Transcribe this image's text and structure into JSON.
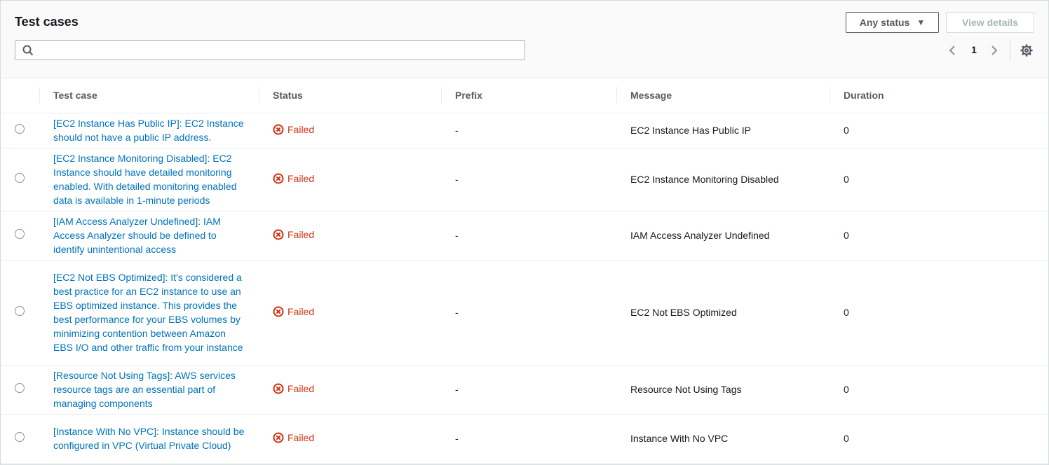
{
  "title": "Test cases",
  "search": {
    "placeholder": "",
    "value": ""
  },
  "filter": {
    "label": "Any status"
  },
  "view_details_label": "View details",
  "pagination": {
    "current_page": "1"
  },
  "columns": [
    "Test case",
    "Status",
    "Prefix",
    "Message",
    "Duration"
  ],
  "rows": [
    {
      "test_case": "[EC2 Instance Has Public IP]: EC2 Instance should not have a public IP address.",
      "status": "Failed",
      "prefix": "-",
      "message": "EC2 Instance Has Public IP",
      "duration": "0"
    },
    {
      "test_case": "[EC2 Instance Monitoring Disabled]: EC2 Instance should have detailed monitoring enabled. With detailed monitoring enabled data is available in 1-minute periods",
      "status": "Failed",
      "prefix": "-",
      "message": "EC2 Instance Monitoring Disabled",
      "duration": "0"
    },
    {
      "test_case": "[IAM Access Analyzer Undefined]: IAM Access Analyzer should be defined to identify unintentional access",
      "status": "Failed",
      "prefix": "-",
      "message": "IAM Access Analyzer Undefined",
      "duration": "0"
    },
    {
      "test_case": "[EC2 Not EBS Optimized]: It's considered a best practice for an EC2 instance to use an EBS optimized instance. This provides the best performance for your EBS volumes by minimizing contention between Amazon EBS I/O and other traffic from your instance",
      "status": "Failed",
      "prefix": "-",
      "message": "EC2 Not EBS Optimized",
      "duration": "0"
    },
    {
      "test_case": "[Resource Not Using Tags]: AWS services resource tags are an essential part of managing components",
      "status": "Failed",
      "prefix": "-",
      "message": "Resource Not Using Tags",
      "duration": "0"
    },
    {
      "test_case": "[Instance With No VPC]: Instance should be configured in VPC (Virtual Private Cloud)",
      "status": "Failed",
      "prefix": "-",
      "message": "Instance With No VPC",
      "duration": "0"
    }
  ],
  "colors": {
    "link": "#0073bb",
    "failed": "#d13212",
    "header_bg": "#fafafa",
    "border": "#eaeded"
  }
}
